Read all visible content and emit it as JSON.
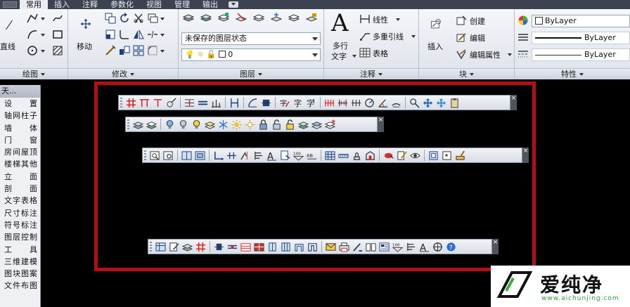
{
  "menubar": {
    "items": [
      "常用",
      "插入",
      "注释",
      "参数化",
      "视图",
      "管理",
      "输出"
    ],
    "active_index": 0
  },
  "ribbon": {
    "draw": {
      "title": "绘图",
      "line_label": "直线"
    },
    "modify": {
      "title": "修改",
      "move_label": "移动"
    },
    "layers": {
      "title": "图层",
      "layer_state": "未保存的图层状态",
      "current_layer": "0"
    },
    "annotation": {
      "title": "注释",
      "mtext_label_1": "多行",
      "mtext_label_2": "文字",
      "linear_label": "线性",
      "multileader_label": "多重引线",
      "table_label": "表格"
    },
    "block": {
      "title": "块",
      "insert_label": "插入",
      "create_label": "创建",
      "edit_label": "编辑",
      "edit_attr_label": "编辑属性"
    },
    "properties": {
      "title": "特性",
      "color_value": "ByLayer",
      "linetype_value": "ByLayer",
      "lineweight_value": "ByLayer"
    }
  },
  "left_palette": {
    "header": "天...",
    "items": [
      "设 置",
      "轴网柱子",
      "墙 体",
      "门 窗",
      "房间屋顶",
      "楼梯其他",
      "立 面",
      "剖 面",
      "文字表格",
      "尺寸标注",
      "符号标注",
      "图层控制",
      "工 具",
      "三维建模",
      "图块图案",
      "文件布图"
    ]
  },
  "toolbars": {
    "close_glyph": "×"
  },
  "watermark": {
    "brand": "爱纯净",
    "url": "www.aichunjing.com"
  },
  "colors": {
    "frame": "#b30f13",
    "menubar": "#3c4350",
    "canvas": "#000000"
  }
}
